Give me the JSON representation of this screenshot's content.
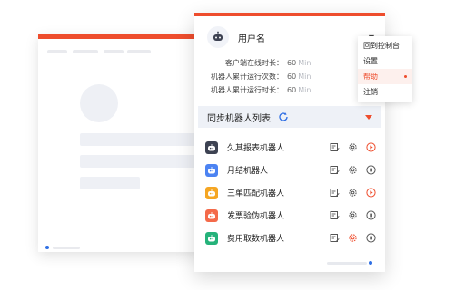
{
  "user": {
    "name": "用户名"
  },
  "stats": [
    {
      "label": "客户端在线时长：",
      "value": "60",
      "unit": "Min"
    },
    {
      "label": "机器人累计运行次数：",
      "value": "60",
      "unit": "Min"
    },
    {
      "label": "机器人累计运行时长：",
      "value": "60",
      "unit": "Min"
    }
  ],
  "menu": {
    "items": [
      {
        "label": "回到控制台"
      },
      {
        "label": "设置"
      },
      {
        "label": "帮助"
      },
      {
        "label": "注销"
      }
    ],
    "active_index": 2
  },
  "sync": {
    "title": "同步机器人列表"
  },
  "robots": [
    {
      "name": "久其报表机器人",
      "icon_color": "#3d4252",
      "run_state": "play"
    },
    {
      "name": "月结机器人",
      "icon_color": "#4c83f2",
      "run_state": "pause"
    },
    {
      "name": "三单匹配机器人",
      "icon_color": "#f5a623",
      "run_state": "play"
    },
    {
      "name": "发票验伪机器人",
      "icon_color": "#f46a4a",
      "run_state": "pause"
    },
    {
      "name": "费用取数机器人",
      "icon_color": "#25b27a",
      "run_state": "pause"
    }
  ],
  "colors": {
    "accent": "#ee4d2d",
    "blue": "#2f6fe4"
  }
}
